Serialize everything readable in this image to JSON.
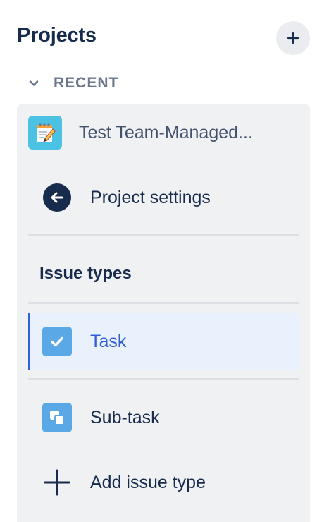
{
  "header": {
    "title": "Projects",
    "add_button_icon": "plus-icon"
  },
  "recent": {
    "label": "RECENT",
    "icon": "chevron-down-icon"
  },
  "project": {
    "name": "Test Team-Managed...",
    "avatar_icon": "notepad-icon",
    "avatar_color": "#4bc1e3"
  },
  "nav": {
    "settings_label": "Project settings",
    "settings_icon": "back-arrow-icon",
    "issue_types_heading": "Issue types",
    "issue_types": [
      {
        "label": "Task",
        "icon": "checkbox-icon",
        "selected": true
      },
      {
        "label": "Sub-task",
        "icon": "subtask-icon",
        "selected": false
      }
    ],
    "add_label": "Add issue type",
    "add_icon": "plus-icon"
  },
  "colors": {
    "selected_bg": "#e9f1fd",
    "selected_text": "#2f5fd0",
    "accent_bar": "#2f62d8",
    "panel_bg": "#f0f1f3",
    "issue_icon_bg": "#5aa8e6"
  }
}
